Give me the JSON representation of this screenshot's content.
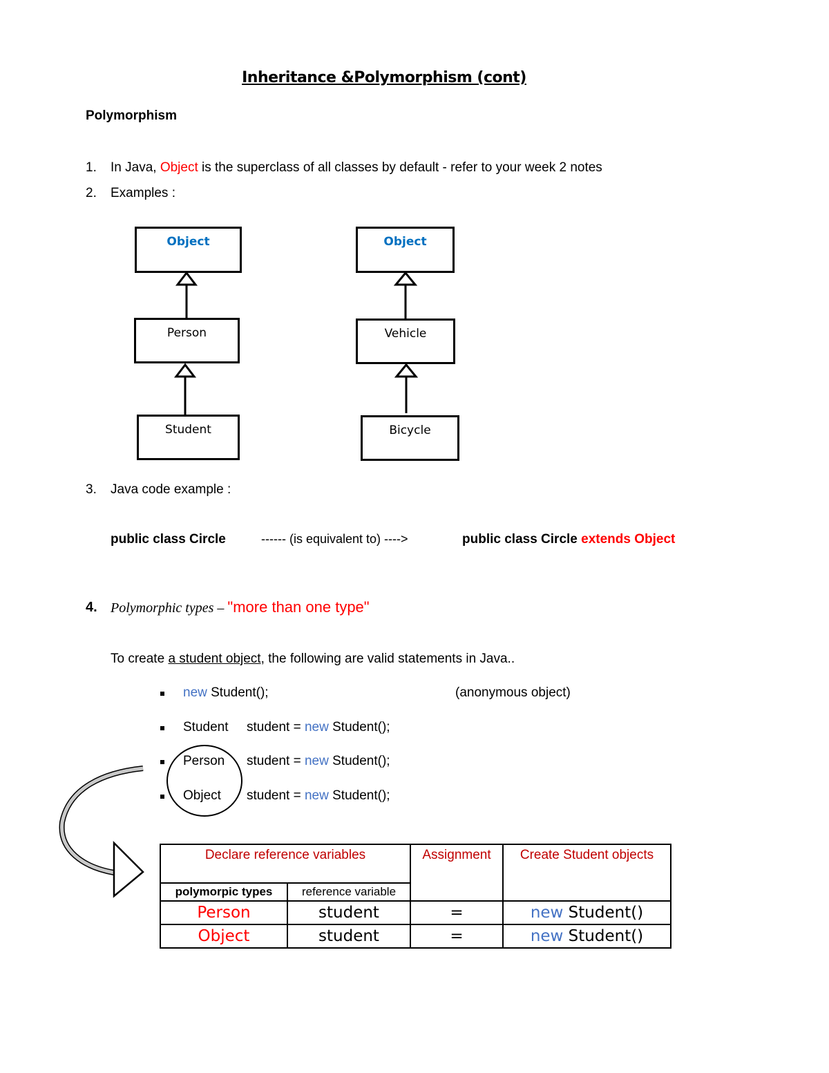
{
  "title": "Inheritance &Polymorphism (cont)",
  "section_heading": "Polymorphism",
  "items": [
    {
      "num": "1.",
      "parts": [
        "In Java, ",
        "Object",
        " is the superclass of all classes by default - refer to your week 2 notes"
      ]
    },
    {
      "num": "2.",
      "text": "Examples :"
    },
    {
      "num": "3.",
      "text": "Java code example :"
    },
    {
      "num": "4.",
      "italic": "Polymorphic types",
      "dash": " – ",
      "quote": "\"more than one type\""
    }
  ],
  "diagrams": {
    "left": [
      "Object",
      "Person",
      "Student"
    ],
    "right": [
      "Object",
      "Vehicle",
      "Bicycle"
    ]
  },
  "code_example": {
    "left": "public class Circle",
    "middle": "------ (is equivalent to) ---->",
    "right_black": "public class Circle",
    "right_red": " extends Object"
  },
  "intro": {
    "pre": "To create ",
    "underlined": "a student object",
    "post": ", the following are valid statements in Java.."
  },
  "statements": [
    {
      "type": "",
      "kw": "new",
      "rest": " Student();",
      "comment": "(anonymous object)"
    },
    {
      "type": "Student",
      "var": "student = ",
      "kw": "new",
      "rest": " Student();"
    },
    {
      "type": "Person",
      "var": "student = ",
      "kw": "new",
      "rest": " Student();"
    },
    {
      "type": "Object",
      "var": "student = ",
      "kw": "new",
      "rest": " Student();"
    }
  ],
  "table": {
    "headers": [
      "Declare reference variables",
      "Assignment",
      "Create Student objects"
    ],
    "subheaders": [
      "polymorpic types",
      "reference variable"
    ],
    "rows": [
      {
        "type": "Person",
        "var": "student",
        "assign": "=",
        "kw": "new",
        "ctor": " Student()"
      },
      {
        "type": "Object",
        "var": "student",
        "assign": "=",
        "kw": "new",
        "ctor": " Student()"
      }
    ]
  }
}
